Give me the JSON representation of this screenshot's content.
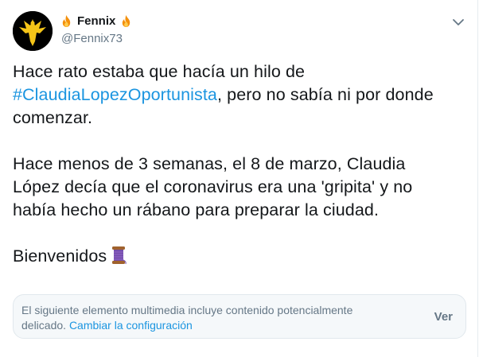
{
  "header": {
    "display_name": "Fennix",
    "handle": "@Fennix73",
    "name_emoji_left": "fire-icon",
    "name_emoji_right": "fire-icon"
  },
  "tweet": {
    "line1_text": "Hace rato estaba que hacía un hilo de",
    "hashtag": "#ClaudiaLopezOportunista",
    "line2_rest": ", pero no sabía ni por donde",
    "line3_text": "comenzar.",
    "para2_line1": "Hace menos de 3 semanas, el 8 de marzo, Claudia",
    "para2_line2": "López decía que el coronavirus era una 'gripita' y no",
    "para2_line3": "había hecho un rábano para preparar la ciudad.",
    "closing_text": "Bienvenidos",
    "closing_emoji": "thread-spool-icon"
  },
  "sensitive_notice": {
    "text": "El siguiente elemento multimedia incluye contenido potencialmente delicado.",
    "link_label": "Cambiar la configuración",
    "view_label": "Ver"
  },
  "colors": {
    "link": "#1b95e0",
    "secondary_text": "#657786",
    "primary_text": "#14171a",
    "notice_bg": "#f5f8fa",
    "fire": "#f4900c",
    "spool": "#744eaa"
  }
}
